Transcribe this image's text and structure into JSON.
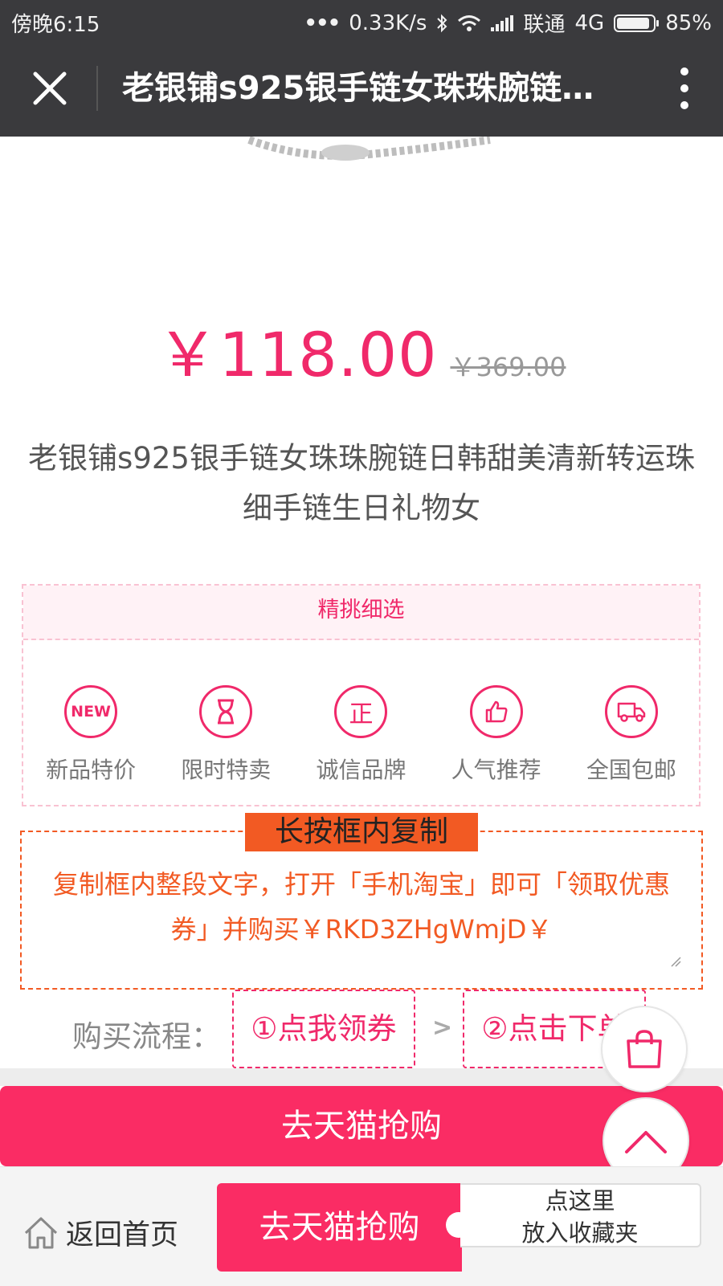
{
  "status_bar": {
    "time": "傍晚6:15",
    "network_speed": "0.33K/s",
    "carrier": "联通",
    "network_type": "4G",
    "battery": "85%"
  },
  "title_bar": {
    "title": "老银铺s925银手链女珠珠腕链…"
  },
  "price": {
    "current": "￥118.00",
    "original": "￥369.00"
  },
  "product": {
    "title": "老银铺s925银手链女珠珠腕链日韩甜美清新转运珠细手链生日礼物女"
  },
  "features": {
    "header": "精挑细选",
    "items": [
      {
        "label": "新品特价",
        "icon": "new-icon",
        "icon_text": "NEW"
      },
      {
        "label": "限时特卖",
        "icon": "hourglass-icon"
      },
      {
        "label": "诚信品牌",
        "icon": "zheng-icon",
        "icon_text": "正"
      },
      {
        "label": "人气推荐",
        "icon": "thumbs-up-icon"
      },
      {
        "label": "全国包邮",
        "icon": "truck-icon"
      }
    ]
  },
  "copy_box": {
    "badge": "长按框内复制",
    "text": "复制框内整段文字，打开「手机淘宝」即可「领取优惠券」并购买￥RKD3ZHgWmjD￥"
  },
  "flow": {
    "label": "购买流程：",
    "step1": "①点我领券",
    "arrow": ">",
    "step2": "②点击下单"
  },
  "cta": {
    "label": "去天猫抢购"
  },
  "bottom_bar": {
    "home_label": "返回首页",
    "buy_label": "去天猫抢购",
    "fav_line1": "点这里",
    "fav_line2": "放入收藏夹"
  },
  "colors": {
    "accent": "#f0296a",
    "cta": "#fa2c64",
    "copy_orange": "#f25a23",
    "title_bar": "#3a3a3d"
  }
}
